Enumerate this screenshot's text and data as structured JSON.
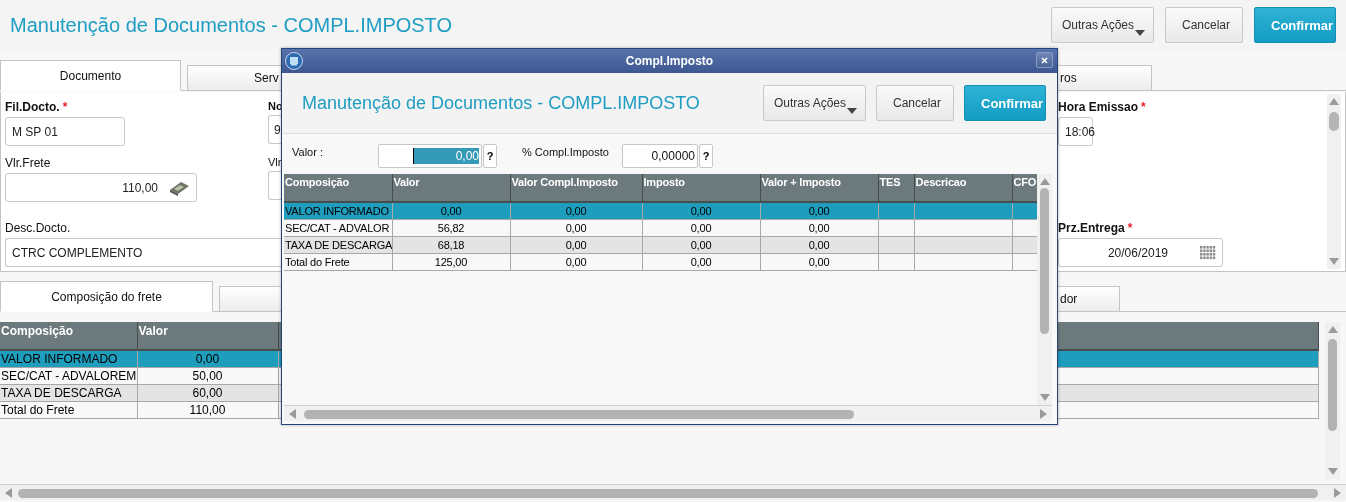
{
  "page": {
    "title": "Manutenção de Documentos - COMPL.IMPOSTO",
    "buttons": [
      {
        "label": "Outras Ações",
        "kind": "menu"
      },
      {
        "label": "Cancelar",
        "kind": "default"
      },
      {
        "label": "Confirmar",
        "kind": "primary"
      }
    ]
  },
  "document_tabs": [
    {
      "label": "Documento",
      "selected": true
    },
    {
      "label": "Serv",
      "selected": false
    },
    {
      "label": "ros",
      "selected": false
    }
  ],
  "form": {
    "fields": [
      {
        "label": "Fil.Docto.",
        "required_mark": "*",
        "value": "M SP 01",
        "kind": "text"
      },
      {
        "label": "No",
        "value": "9",
        "kind": "text"
      },
      {
        "label": "Hora Emissao",
        "required_mark": "*",
        "value": "18:06",
        "kind": "text"
      },
      {
        "label": "Vlr.Frete",
        "value": "110,00",
        "kind": "money"
      },
      {
        "label": "Vlr",
        "kind": "text"
      },
      {
        "label": "Desc.Docto.",
        "value": "CTRC COMPLEMENTO",
        "kind": "text"
      },
      {
        "label": "Prz.Entrega",
        "required_mark": "*",
        "value": "20/06/2019",
        "kind": "date"
      }
    ]
  },
  "lower_tabs": [
    {
      "label": "Composição do frete",
      "selected": true
    },
    {
      "selected": false
    },
    {
      "label": "dor",
      "selected": false
    }
  ],
  "freight_grid": {
    "columns": [
      "Composição",
      "Valor"
    ],
    "rows": [
      {
        "cells": [
          "VALOR INFORMADO",
          "0,00"
        ],
        "selected": true
      },
      {
        "cells": [
          "SEC/CAT - ADVALOREM",
          "50,00"
        ],
        "selected": false
      },
      {
        "cells": [
          "TAXA DE DESCARGA",
          "60,00"
        ],
        "selected": false
      },
      {
        "cells": [
          "Total do Frete",
          "110,00"
        ],
        "selected": false
      }
    ]
  },
  "dialog": {
    "title": "Compl.Imposto",
    "heading": "Manutenção de Documentos - COMPL.IMPOSTO",
    "buttons": [
      {
        "label": "Outras Ações",
        "kind": "menu"
      },
      {
        "label": "Cancelar",
        "kind": "default"
      },
      {
        "label": "Confirmar",
        "kind": "primary"
      }
    ],
    "fields": [
      {
        "label": "Valor :",
        "value": "0,00",
        "selected": true,
        "help": "?"
      },
      {
        "label": "% Compl.Imposto",
        "value": "0,00000",
        "selected": false,
        "help": "?"
      }
    ],
    "grid": {
      "columns": [
        "Composição",
        "Valor",
        "Valor Compl.Imposto",
        "Imposto",
        "Valor + Imposto",
        "TES",
        "Descricao",
        "CFO"
      ],
      "rows": [
        {
          "cells": [
            "VALOR INFORMADO",
            "0,00",
            "0,00",
            "0,00",
            "0,00",
            "",
            "",
            ""
          ],
          "selected": true
        },
        {
          "cells": [
            "SEC/CAT - ADVALOR",
            "56,82",
            "0,00",
            "0,00",
            "0,00",
            "",
            "",
            ""
          ],
          "selected": false
        },
        {
          "cells": [
            "TAXA DE DESCARGA",
            "68,18",
            "0,00",
            "0,00",
            "0,00",
            "",
            "",
            ""
          ],
          "selected": false
        },
        {
          "cells": [
            "Total do Frete",
            "125,00",
            "0,00",
            "0,00",
            "0,00",
            "",
            "",
            ""
          ],
          "selected": false
        }
      ]
    }
  }
}
